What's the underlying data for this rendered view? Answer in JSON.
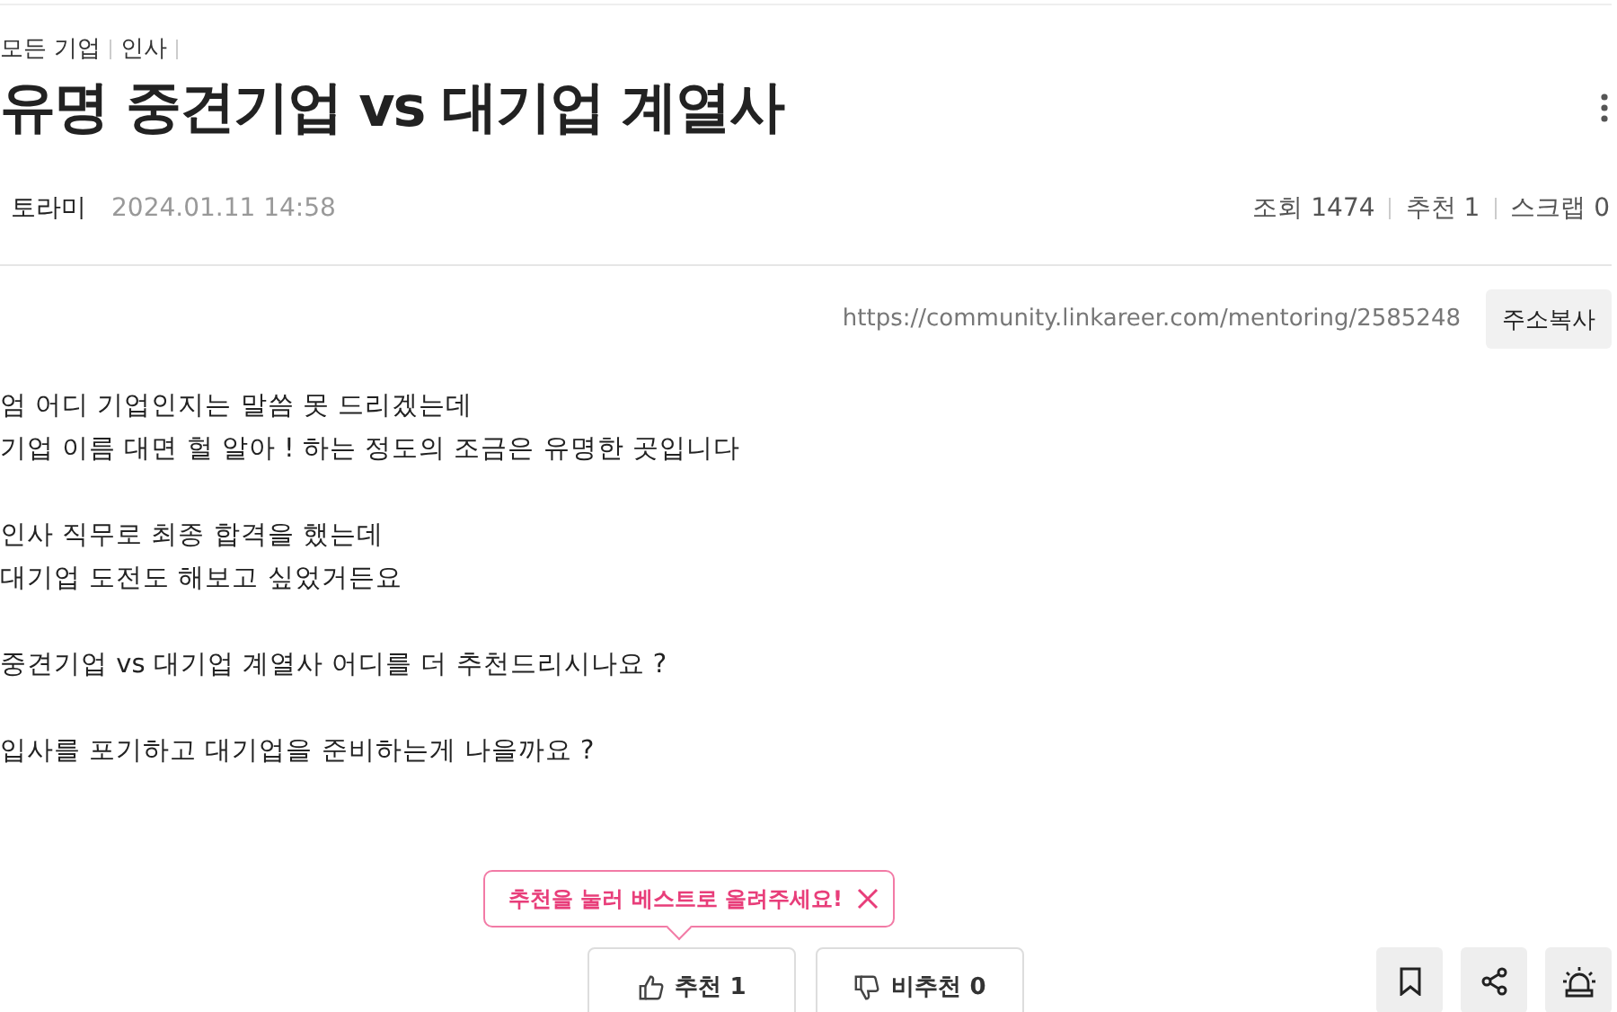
{
  "breadcrumb": [
    "모든 기업",
    "인사"
  ],
  "title": "유명 중견기업 vs 대기업 계열사",
  "author": "토라미",
  "date": "2024.01.11 14:58",
  "stats": [
    {
      "label": "조회",
      "value": "1474"
    },
    {
      "label": "추천",
      "value": "1"
    },
    {
      "label": "스크랩",
      "value": "0"
    }
  ],
  "url": "https://community.linkareer.com/mentoring/2585248",
  "copy_button": "주소복사",
  "body": [
    "엄 어디 기업인지는 말씀 못 드리겠는데\n기업 이름 대면 헐 알아 ! 하는 정도의 조금은 유명한 곳입니다",
    "인사 직무로 최종 합격을 했는데\n대기업 도전도 해보고 싶었거든요",
    "중견기업 vs 대기업 계열사 어디를 더 추천드리시나요 ?",
    "입사를 포기하고 대기업을 준비하는게 나을까요 ?"
  ],
  "tooltip": "추천을 눌러 베스트로 올려주세요!",
  "votes": [
    {
      "kind": "up",
      "label": "추천",
      "count": "1"
    },
    {
      "kind": "down",
      "label": "비추천",
      "count": "0"
    }
  ],
  "actions": [
    {
      "kind": "bookmark"
    },
    {
      "kind": "share"
    },
    {
      "kind": "report"
    }
  ]
}
